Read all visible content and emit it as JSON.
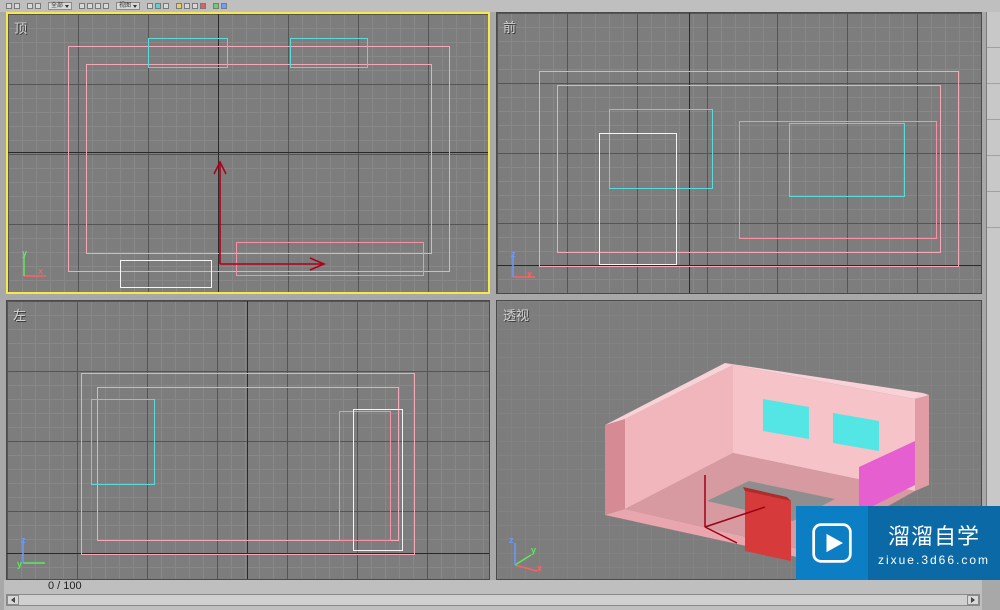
{
  "viewports": {
    "top": {
      "label": "顶",
      "active": true
    },
    "front": {
      "label": "前",
      "active": false
    },
    "left": {
      "label": "左",
      "active": false
    },
    "persp": {
      "label": "透视",
      "active": false
    }
  },
  "axes": {
    "x": "x",
    "y": "y",
    "z": "z"
  },
  "timeline": {
    "current_frame": "0",
    "total_frames": "100",
    "separator": "/",
    "display": "0 / 100"
  },
  "watermark": {
    "title": "溜溜自学",
    "subtitle": "zixue.3d66.com"
  },
  "toolbar": {
    "dropdown1": "全部",
    "dropdown2": "视图"
  },
  "colors": {
    "active_border": "#f7e94a",
    "grid_bg": "#7d7d7d",
    "pink": "#f5a8b8",
    "cyan": "#5adada",
    "brand_blue": "#0c7ec4"
  }
}
